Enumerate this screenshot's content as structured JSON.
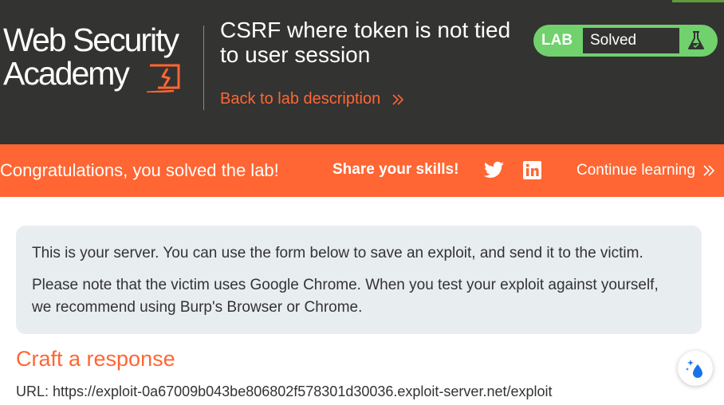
{
  "header": {
    "logo": {
      "line1": "Web Security",
      "line2": "Academy"
    },
    "lab_title": "CSRF where token is not tied to user session",
    "back_link": "Back to lab description",
    "status": {
      "tag": "LAB",
      "value": "Solved",
      "icon": "flask-icon",
      "accent_color": "#70d16d"
    },
    "brand_color": "#ff6633",
    "background_color": "#333332"
  },
  "banner": {
    "message": "Congratulations, you solved the lab!",
    "share_label": "Share your skills!",
    "share_icons": [
      "twitter-icon",
      "linkedin-icon"
    ],
    "continue_label": "Continue learning"
  },
  "info": {
    "paragraph1": "This is your server. You can use the form below to save an exploit, and send it to the victim.",
    "paragraph2": "Please note that the victim uses Google Chrome. When you test your exploit against yourself, we recommend using Burp's Browser or Chrome."
  },
  "craft": {
    "heading": "Craft a response",
    "url_line": "URL: https://exploit-0a67009b043be806802f578301d30036.exploit-server.net/exploit"
  },
  "floating_button": {
    "icon": "sparkle-drop-icon"
  }
}
